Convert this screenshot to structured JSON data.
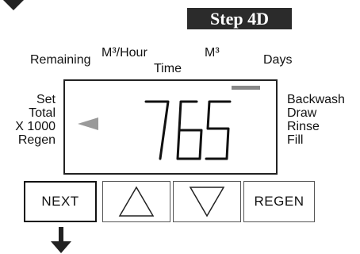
{
  "step_badge": "Step 4D",
  "header_labels": {
    "remaining": "Remaining",
    "m3_per_hour": "M³/Hour",
    "time": "Time",
    "m3": "M³",
    "days": "Days"
  },
  "left_labels": [
    "Set",
    "Total",
    "X 1000",
    "Regen"
  ],
  "right_labels": [
    "Backwash",
    "Draw",
    "Rinse",
    "Fill"
  ],
  "display": {
    "digits": "765",
    "pointer": "left-triangle",
    "indicator": "bar"
  },
  "buttons": {
    "next": "NEXT",
    "up_icon": "up-triangle-icon",
    "down_icon": "down-triangle-icon",
    "regen": "REGEN"
  },
  "colors": {
    "badge_bg": "#2b2b2b",
    "pointer": "#9a9a9a",
    "indicator": "#888888"
  }
}
